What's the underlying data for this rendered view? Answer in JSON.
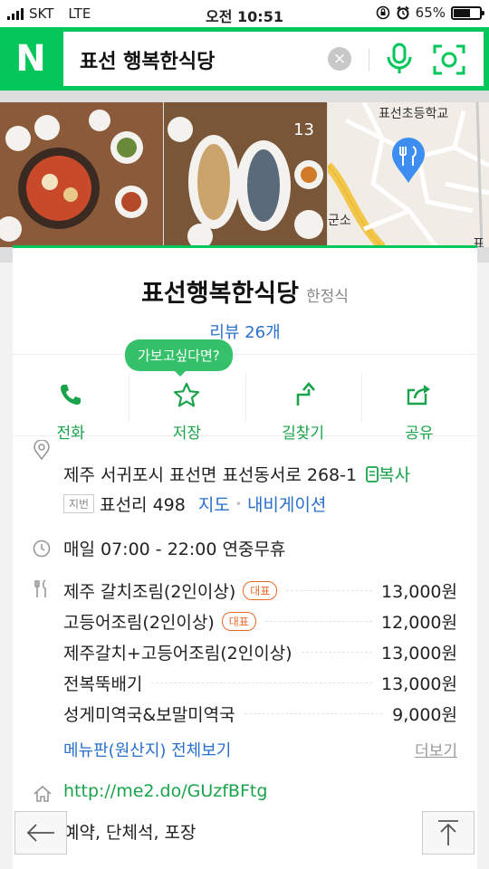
{
  "status_bar": {
    "carrier": "SKT",
    "network": "LTE",
    "time": "오전 10:51",
    "battery": "65%",
    "battery_level": 0.65
  },
  "search": {
    "logo": "N",
    "query": "표선 행복한식당",
    "clear_icon": "×"
  },
  "gallery": {
    "photo_count": "13",
    "map_labels": [
      "표선초등학교",
      "군소",
      "표선"
    ]
  },
  "place": {
    "name": "표선행복한식당",
    "category": "한정식",
    "reviews": "리뷰 26개"
  },
  "tooltip": "가보고싶다면?",
  "actions": [
    {
      "label": "전화",
      "icon": "phone-icon"
    },
    {
      "label": "저장",
      "icon": "star-icon"
    },
    {
      "label": "길찾기",
      "icon": "directions-icon"
    },
    {
      "label": "공유",
      "icon": "share-icon"
    }
  ],
  "info": {
    "address": "제주 서귀포시 표선면 표선동서로 268-1",
    "copy_label": "복사",
    "jibun_tag": "지번",
    "jibun": "표선리 498",
    "map_link": "지도",
    "nav_link": "내비게이션",
    "hours": "매일 07:00 - 22:00 연중무휴",
    "menu": [
      {
        "name": "제주 갈치조림(2인이상)",
        "badge": "대표",
        "price": "13,000원"
      },
      {
        "name": "고등어조림(2인이상)",
        "badge": "대표",
        "price": "12,000원"
      },
      {
        "name": "제주갈치+고등어조림(2인이상)",
        "badge": "",
        "price": "13,000원"
      },
      {
        "name": "전복뚝배기",
        "badge": "",
        "price": "13,000원"
      },
      {
        "name": "성게미역국&보말미역국",
        "badge": "",
        "price": "9,000원"
      }
    ],
    "menu_board_link": "메뉴판(원산지) 전체보기",
    "more_link": "더보기",
    "url": "http://me2.do/GUzfBFtg",
    "extras": "예약, 단체석, 포장"
  },
  "colors": {
    "brand": "#03c75a",
    "link": "#2a6fcb",
    "action_text": "#19a34a",
    "badge": "#e86a2a"
  }
}
